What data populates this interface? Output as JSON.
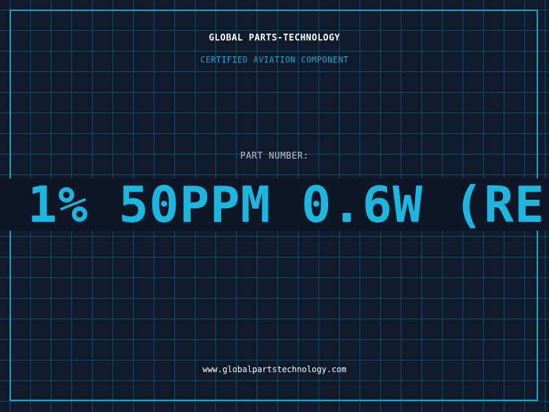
{
  "header": {
    "company": "GLOBAL PARTS-TECHNOLOGY",
    "tagline": "CERTIFIED AVIATION COMPONENT"
  },
  "part": {
    "label": "PART NUMBER:",
    "value": "1% 50PPM 0.6W (RE"
  },
  "footer": {
    "url": "www.globalpartstechnology.com"
  },
  "colors": {
    "background": "#111a2b",
    "grid": "#1d4a5e",
    "accent": "#1aa6cf",
    "part_text": "#1ab8e0",
    "band": "#0f1626"
  }
}
